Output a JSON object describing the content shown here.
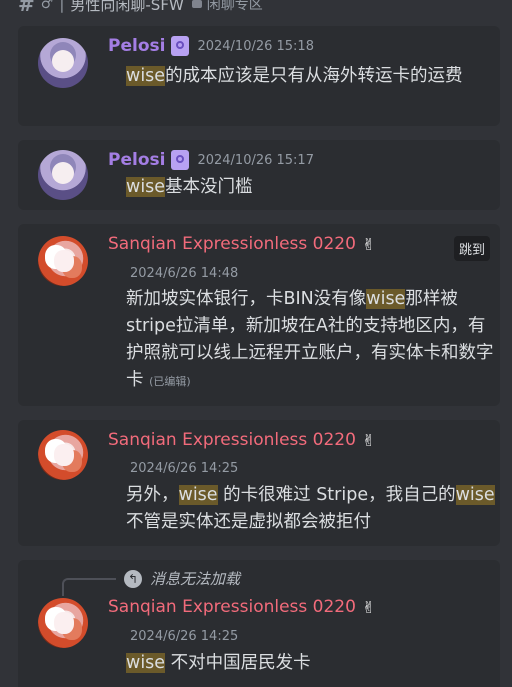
{
  "header": {
    "hash": "#",
    "emoji": "♂",
    "separator": "|",
    "channel": "男性向闲聊-SFW",
    "category": "闲聊专区"
  },
  "messages": [
    {
      "author": "Pelosi",
      "timestamp": "2024/10/26 15:18",
      "highlight": "wise",
      "text": "的成本应该是只有从海外转运卡的运费"
    },
    {
      "author": "Pelosi",
      "timestamp": "2024/10/26 15:17",
      "highlight": "wise",
      "text": "基本没门槛"
    },
    {
      "author": "Sanqian Expressionless 0220",
      "timestamp": "2024/6/26 14:48",
      "jump_label": "跳到",
      "text_before": "新加坡实体银行，卡BIN没有像",
      "highlight": "wise",
      "text_after": "那样被stripe拉清单，新加坡在A社的支持地区内，有护照就可以线上远程开立账户，有实体卡和数字卡",
      "edited": "(已编辑)"
    },
    {
      "author": "Sanqian Expressionless 0220",
      "timestamp": "2024/6/26 14:25",
      "text_before": "另外，",
      "highlight1": "wise",
      "text_mid": " 的卡很难过 Stripe，我自己的",
      "highlight2": "wise",
      "text_after": " 不管是实体还是虚拟都会被拒付"
    },
    {
      "reply_text": "消息无法加载",
      "author": "Sanqian Expressionless 0220",
      "timestamp": "2024/6/26 14:25",
      "highlight": "wise",
      "text": " 不对中国居民发卡"
    }
  ],
  "colors": {
    "background": "#313338",
    "card": "#2b2d31",
    "pelosi_name": "#a47ee4",
    "sanqian_name": "#f26b7b",
    "highlight": "#6b5a2a"
  }
}
